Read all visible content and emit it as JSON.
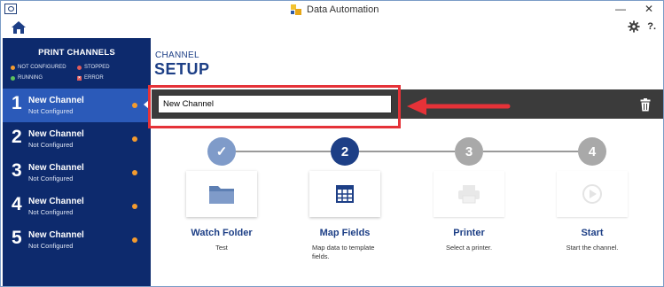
{
  "window": {
    "title": "Data Automation",
    "minimize": "—",
    "close": "✕"
  },
  "toolbar": {
    "help_label": "?."
  },
  "sidebar": {
    "title": "PRINT CHANNELS",
    "legend": [
      {
        "label": "NOT CONFIGURED",
        "color": "#f39b2f"
      },
      {
        "label": "STOPPED",
        "color": "#e05b5b"
      },
      {
        "label": "RUNNING",
        "color": "#5cc25c"
      },
      {
        "label": "ERROR",
        "color": "#e05b5b"
      }
    ],
    "channels": [
      {
        "number": "1",
        "name": "New Channel",
        "status": "Not Configured",
        "active": true
      },
      {
        "number": "2",
        "name": "New Channel",
        "status": "Not Configured",
        "active": false
      },
      {
        "number": "3",
        "name": "New Channel",
        "status": "Not Configured",
        "active": false
      },
      {
        "number": "4",
        "name": "New Channel",
        "status": "Not Configured",
        "active": false
      },
      {
        "number": "5",
        "name": "New Channel",
        "status": "Not Configured",
        "active": false
      }
    ]
  },
  "main": {
    "label_small": "CHANNEL",
    "label_large": "SETUP",
    "channel_name_value": "New Channel"
  },
  "steps": [
    {
      "number": "✓",
      "title": "Watch Folder",
      "description": "Test",
      "state": "done",
      "icon": "folder-icon"
    },
    {
      "number": "2",
      "title": "Map Fields",
      "description": "Map data to template fields.",
      "state": "current",
      "icon": "grid-icon"
    },
    {
      "number": "3",
      "title": "Printer",
      "description": "Select a printer.",
      "state": "pending",
      "icon": "printer-icon"
    },
    {
      "number": "4",
      "title": "Start",
      "description": "Start the channel.",
      "state": "pending",
      "icon": "play-icon"
    }
  ],
  "colors": {
    "sidebar_bg": "#0d2a6d",
    "sidebar_active": "#2b5ab9",
    "accent_blue": "#1d3f86",
    "step_done": "#7f9bc9",
    "step_current": "#1d3f86",
    "step_pending": "#a9a9a9",
    "highlight_red": "#e53238",
    "status_orange": "#f39b2f"
  }
}
